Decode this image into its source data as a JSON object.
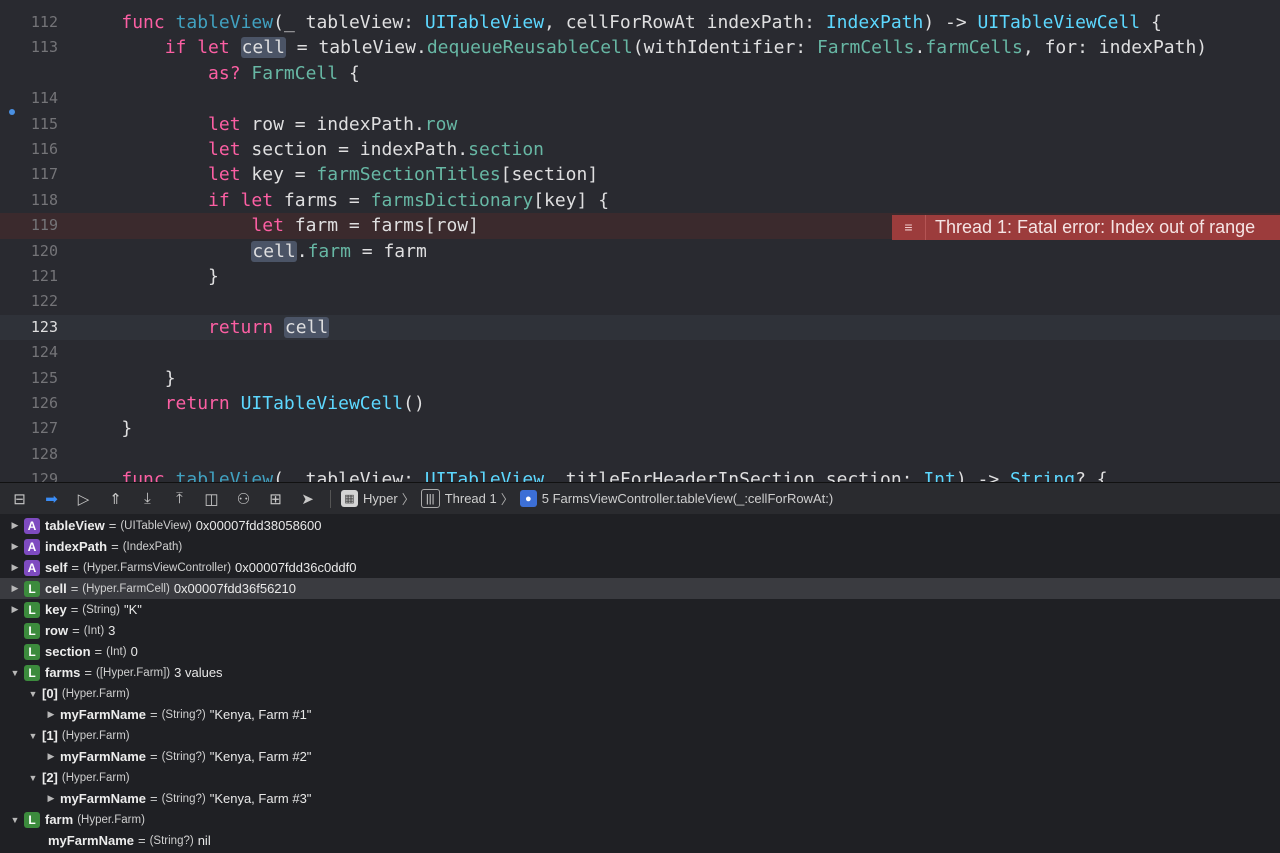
{
  "editor": {
    "lines": [
      {
        "num": "112",
        "tokens": [
          {
            "t": "    ",
            "c": "plain"
          },
          {
            "t": "func",
            "c": "kw"
          },
          {
            "t": " ",
            "c": "plain"
          },
          {
            "t": "tableView",
            "c": "decl"
          },
          {
            "t": "(_ tableView: ",
            "c": "plain"
          },
          {
            "t": "UITableView",
            "c": "type"
          },
          {
            "t": ", cellForRowAt indexPath: ",
            "c": "plain"
          },
          {
            "t": "IndexPath",
            "c": "type"
          },
          {
            "t": ") -> ",
            "c": "plain"
          },
          {
            "t": "UITableViewCell",
            "c": "type"
          },
          {
            "t": " {",
            "c": "plain"
          }
        ]
      },
      {
        "num": "113",
        "tokens": [
          {
            "t": "        ",
            "c": "plain"
          },
          {
            "t": "if let",
            "c": "kw"
          },
          {
            "t": " ",
            "c": "plain"
          },
          {
            "t": "cell",
            "c": "hl"
          },
          {
            "t": " = tableView.",
            "c": "plain"
          },
          {
            "t": "dequeueReusableCell",
            "c": "sys"
          },
          {
            "t": "(withIdentifier: ",
            "c": "plain"
          },
          {
            "t": "FarmCells",
            "c": "proj"
          },
          {
            "t": ".",
            "c": "plain"
          },
          {
            "t": "farmCells",
            "c": "proj"
          },
          {
            "t": ", for: indexPath)",
            "c": "plain"
          }
        ]
      },
      {
        "num": "",
        "tokens": [
          {
            "t": "            ",
            "c": "plain"
          },
          {
            "t": "as?",
            "c": "kw"
          },
          {
            "t": " ",
            "c": "plain"
          },
          {
            "t": "FarmCell",
            "c": "proj"
          },
          {
            "t": " {",
            "c": "plain"
          }
        ]
      },
      {
        "num": "114",
        "tokens": []
      },
      {
        "num": "115",
        "tokens": [
          {
            "t": "            ",
            "c": "plain"
          },
          {
            "t": "let",
            "c": "kw"
          },
          {
            "t": " row = indexPath.",
            "c": "plain"
          },
          {
            "t": "row",
            "c": "sys"
          }
        ]
      },
      {
        "num": "116",
        "tokens": [
          {
            "t": "            ",
            "c": "plain"
          },
          {
            "t": "let",
            "c": "kw"
          },
          {
            "t": " section = indexPath.",
            "c": "plain"
          },
          {
            "t": "section",
            "c": "sys"
          }
        ]
      },
      {
        "num": "117",
        "tokens": [
          {
            "t": "            ",
            "c": "plain"
          },
          {
            "t": "let",
            "c": "kw"
          },
          {
            "t": " key = ",
            "c": "plain"
          },
          {
            "t": "farmSectionTitles",
            "c": "proj"
          },
          {
            "t": "[section]",
            "c": "plain"
          }
        ]
      },
      {
        "num": "118",
        "tokens": [
          {
            "t": "            ",
            "c": "plain"
          },
          {
            "t": "if let",
            "c": "kw"
          },
          {
            "t": " farms = ",
            "c": "plain"
          },
          {
            "t": "farmsDictionary",
            "c": "proj"
          },
          {
            "t": "[key] {",
            "c": "plain"
          }
        ]
      },
      {
        "num": "119",
        "tokens": [
          {
            "t": "                ",
            "c": "plain"
          },
          {
            "t": "let",
            "c": "kw"
          },
          {
            "t": " farm = farms[row]",
            "c": "plain"
          }
        ],
        "error": true
      },
      {
        "num": "120",
        "tokens": [
          {
            "t": "                ",
            "c": "plain"
          },
          {
            "t": "cell",
            "c": "hl"
          },
          {
            "t": ".",
            "c": "plain"
          },
          {
            "t": "farm",
            "c": "proj"
          },
          {
            "t": " = farm",
            "c": "plain"
          }
        ]
      },
      {
        "num": "121",
        "tokens": [
          {
            "t": "            }",
            "c": "plain"
          }
        ]
      },
      {
        "num": "122",
        "tokens": []
      },
      {
        "num": "123",
        "tokens": [
          {
            "t": "            ",
            "c": "plain"
          },
          {
            "t": "return",
            "c": "kw"
          },
          {
            "t": " ",
            "c": "plain"
          },
          {
            "t": "cell",
            "c": "hl"
          }
        ],
        "current": true
      },
      {
        "num": "124",
        "tokens": []
      },
      {
        "num": "125",
        "tokens": [
          {
            "t": "        }",
            "c": "plain"
          }
        ]
      },
      {
        "num": "126",
        "tokens": [
          {
            "t": "        ",
            "c": "plain"
          },
          {
            "t": "return",
            "c": "kw"
          },
          {
            "t": " ",
            "c": "plain"
          },
          {
            "t": "UITableViewCell",
            "c": "type"
          },
          {
            "t": "()",
            "c": "plain"
          }
        ]
      },
      {
        "num": "127",
        "tokens": [
          {
            "t": "    }",
            "c": "plain"
          }
        ]
      },
      {
        "num": "128",
        "tokens": []
      },
      {
        "num": "129",
        "tokens": [
          {
            "t": "    ",
            "c": "plain"
          },
          {
            "t": "func",
            "c": "kw"
          },
          {
            "t": " ",
            "c": "plain"
          },
          {
            "t": "tableView",
            "c": "decl"
          },
          {
            "t": "(_ tableView: ",
            "c": "plain"
          },
          {
            "t": "UITableView",
            "c": "type"
          },
          {
            "t": ", titleForHeaderInSection section: ",
            "c": "plain"
          },
          {
            "t": "Int",
            "c": "type"
          },
          {
            "t": ") -> ",
            "c": "plain"
          },
          {
            "t": "String",
            "c": "type"
          },
          {
            "t": "? {",
            "c": "plain"
          }
        ]
      }
    ],
    "error_message": "Thread 1: Fatal error: Index out of range",
    "error_icon": "≡"
  },
  "debugbar": {
    "buttons": [
      {
        "name": "hide-debug-area-button",
        "glyph": "⊟"
      },
      {
        "name": "breakpoints-toggle-button",
        "glyph": "➡",
        "active": true
      },
      {
        "name": "continue-button",
        "glyph": "▷"
      },
      {
        "name": "step-over-button",
        "glyph": "⇑"
      },
      {
        "name": "step-into-button",
        "glyph": "⤓"
      },
      {
        "name": "step-out-button",
        "glyph": "⤒"
      },
      {
        "name": "view-hierarchy-button",
        "glyph": "◫"
      },
      {
        "name": "memory-graph-button",
        "glyph": "⚇"
      },
      {
        "name": "environment-overrides-button",
        "glyph": "⊞"
      },
      {
        "name": "simulate-location-button",
        "glyph": "➤"
      }
    ],
    "breadcrumbs": {
      "app": "Hyper",
      "thread": "Thread 1",
      "frame": "5 FarmsViewController.tableView(_:cellForRowAt:)"
    }
  },
  "variables": [
    {
      "indent": 0,
      "tri": "▶",
      "badge": "A",
      "name": "tableView",
      "type": "(UITableView)",
      "value": "0x00007fdd38058600"
    },
    {
      "indent": 0,
      "tri": "▶",
      "badge": "A",
      "name": "indexPath",
      "type": "(IndexPath)",
      "value": ""
    },
    {
      "indent": 0,
      "tri": "▶",
      "badge": "A",
      "name": "self",
      "type": "(Hyper.FarmsViewController)",
      "value": "0x00007fdd36c0ddf0"
    },
    {
      "indent": 0,
      "tri": "▶",
      "badge": "L",
      "name": "cell",
      "type": "(Hyper.FarmCell)",
      "value": "0x00007fdd36f56210",
      "selected": true
    },
    {
      "indent": 0,
      "tri": "▶",
      "badge": "L",
      "name": "key",
      "type": "(String)",
      "value": "\"K\""
    },
    {
      "indent": 0,
      "tri": "",
      "badge": "L",
      "name": "row",
      "type": "(Int)",
      "value": "3"
    },
    {
      "indent": 0,
      "tri": "",
      "badge": "L",
      "name": "section",
      "type": "(Int)",
      "value": "0"
    },
    {
      "indent": 0,
      "tri": "▼",
      "badge": "L",
      "name": "farms",
      "type": "([Hyper.Farm])",
      "value": "3 values"
    },
    {
      "indent": 1,
      "tri": "▼",
      "badge": "",
      "name": "[0]",
      "type": "(Hyper.Farm)",
      "value": "",
      "noeq": true
    },
    {
      "indent": 2,
      "tri": "▶",
      "badge": "",
      "name": "myFarmName",
      "type": "(String?)",
      "value": "\"Kenya, Farm #1\""
    },
    {
      "indent": 1,
      "tri": "▼",
      "badge": "",
      "name": "[1]",
      "type": "(Hyper.Farm)",
      "value": "",
      "noeq": true
    },
    {
      "indent": 2,
      "tri": "▶",
      "badge": "",
      "name": "myFarmName",
      "type": "(String?)",
      "value": "\"Kenya, Farm #2\""
    },
    {
      "indent": 1,
      "tri": "▼",
      "badge": "",
      "name": "[2]",
      "type": "(Hyper.Farm)",
      "value": "",
      "noeq": true
    },
    {
      "indent": 2,
      "tri": "▶",
      "badge": "",
      "name": "myFarmName",
      "type": "(String?)",
      "value": "\"Kenya, Farm #3\""
    },
    {
      "indent": 0,
      "tri": "▼",
      "badge": "L",
      "name": "farm",
      "type": "(Hyper.Farm)",
      "value": "",
      "noeq": true
    },
    {
      "indent": 1,
      "tri": "",
      "badge": "",
      "name": "myFarmName",
      "type": "(String?)",
      "value": "nil",
      "nolead": true
    }
  ]
}
